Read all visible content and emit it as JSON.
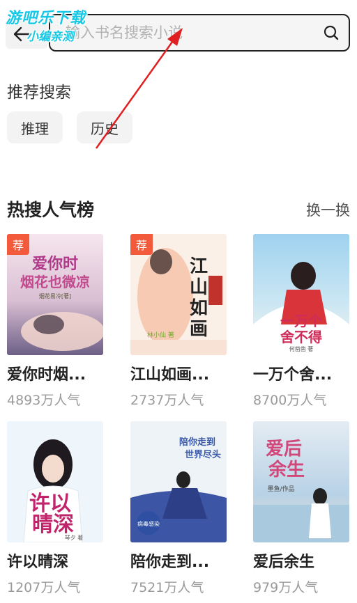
{
  "search": {
    "placeholder": "输入书名搜索小说"
  },
  "watermark": {
    "line1": "游吧乐下载",
    "line2": "小编亲测"
  },
  "recommended": {
    "title": "推荐搜索",
    "chips": [
      "推理",
      "历史"
    ]
  },
  "hot": {
    "title": "热搜人气榜",
    "swap_label": "换一换",
    "badge_label": "荐",
    "books": [
      {
        "title": "爱你时烟...",
        "popularity": "4893万人气",
        "badge": true,
        "cover_text": "爱你时烟花也微凉",
        "author": "烟花易冷",
        "colors": {
          "bg1": "#f1d9e6",
          "bg2": "#7b6a8e",
          "text": "#b03a8a"
        }
      },
      {
        "title": "江山如画...",
        "popularity": "2737万人气",
        "badge": true,
        "cover_text": "江山如画",
        "author": "林小仙",
        "colors": {
          "bg1": "#fbeee6",
          "bg2": "#f4b89c",
          "text": "#222222"
        }
      },
      {
        "title": "一万个舍...",
        "popularity": "8700万人气",
        "badge": false,
        "cover_text": "一万个舍不得",
        "author": "何凿凿",
        "colors": {
          "bg1": "#8ec5e8",
          "bg2": "#f5f2ee",
          "text": "#d02c5a"
        }
      },
      {
        "title": "许以晴深",
        "popularity": "1207万人气",
        "badge": false,
        "cover_text": "许以晴深",
        "author": "琴夕",
        "colors": {
          "bg1": "#eaf3fa",
          "bg2": "#cfe3f0",
          "text": "#c2246b"
        }
      },
      {
        "title": "陪你走到...",
        "popularity": "7521万人气",
        "badge": false,
        "cover_text": "陪你走到世界尽头",
        "author": "病毒感染",
        "colors": {
          "bg1": "#eef3f8",
          "bg2": "#3b4f9a",
          "text": "#3b5ba8"
        }
      },
      {
        "title": "爱后余生",
        "popularity": "979万人气",
        "badge": false,
        "cover_text": "爱后余生",
        "author": "墨鱼",
        "colors": {
          "bg1": "#e6eef5",
          "bg2": "#8db6d6",
          "text": "#d2477a"
        }
      }
    ]
  },
  "colors": {
    "accent_badge": "#f35a3c",
    "arrow": "#e02020"
  }
}
